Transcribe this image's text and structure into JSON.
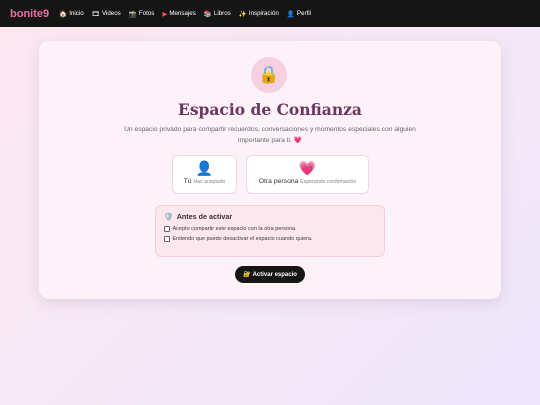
{
  "nav": {
    "brand": "bonite9",
    "items": [
      {
        "icon": "🏠",
        "icon_name": "home-icon",
        "label": "Inicio"
      },
      {
        "icon": "🎞",
        "icon_name": "film-icon",
        "label": "Videos"
      },
      {
        "icon": "📸",
        "icon_name": "camera-icon",
        "label": "Fotos"
      },
      {
        "icon": "▶",
        "icon_name": "play-icon",
        "label": "Mensajes"
      },
      {
        "icon": "📚",
        "icon_name": "books-icon",
        "label": "Libros"
      },
      {
        "icon": "✨",
        "icon_name": "sparkles-icon",
        "label": "Inspiración"
      },
      {
        "icon": "👤",
        "icon_name": "user-icon",
        "label": "Perfil"
      }
    ]
  },
  "main": {
    "lock_icon": "🔒",
    "title": "Espacio de Confianza",
    "subtitle": "Un espacio privado para compartir recuerdos, conversaciones y momentos especiales con alguien importante para ti.",
    "subtitle_heart": "💗",
    "participants": {
      "you": {
        "icon": "👤",
        "name": "Tú",
        "status": "Has aceptado"
      },
      "other": {
        "icon": "💗",
        "name": "Otra persona",
        "status": "Esperando confirmación"
      }
    },
    "terms": {
      "icon": "🛡️",
      "title": "Antes de activar",
      "items": [
        "Acepto compartir este espacio con la otra persona.",
        "Entiendo que puedo desactivar el espacio cuando quiera."
      ]
    },
    "activate_button": {
      "icon": "🔐",
      "label": "Activar espacio"
    }
  },
  "colors": {
    "brand": "#f06aa5",
    "title": "#6d3560",
    "nav_bg": "#151515",
    "card_bg": "#fdf2f7",
    "button_bg": "#161616"
  }
}
